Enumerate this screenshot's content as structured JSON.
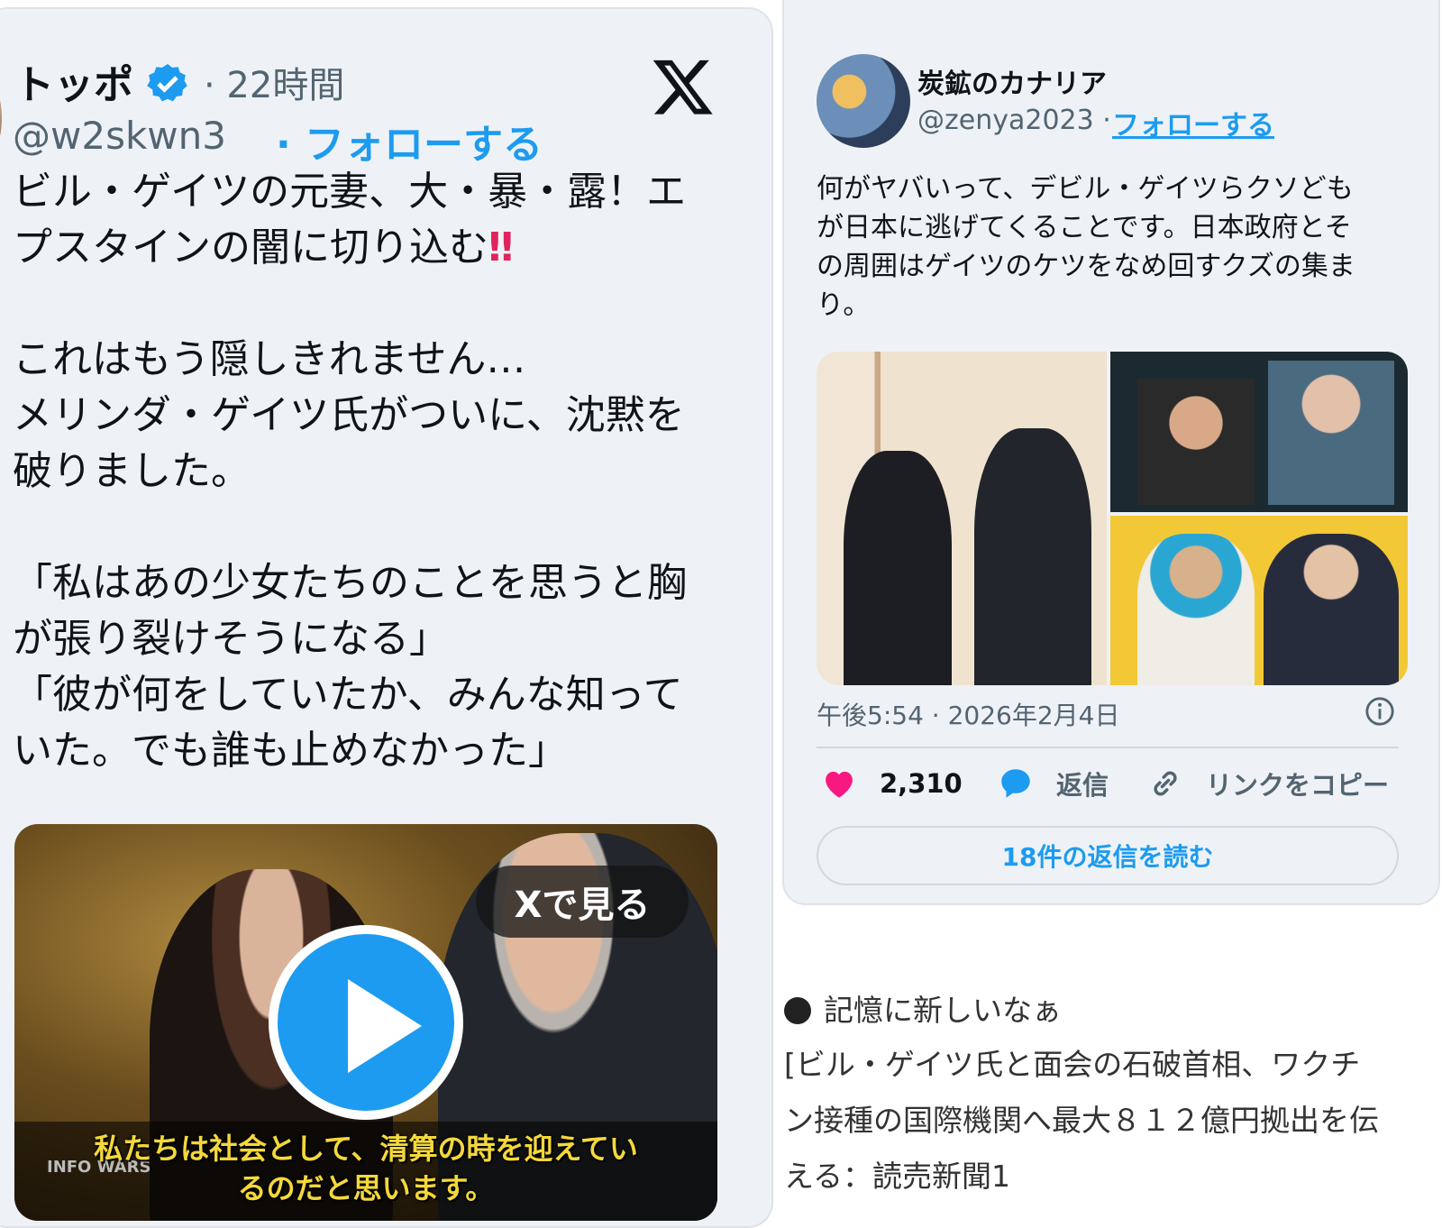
{
  "left_tweet": {
    "display_name": "トッポ",
    "time": "· 22時間",
    "handle": "@w2skwn3",
    "follow_label": "· フォローする",
    "body_lines": [
      "ビル・ゲイツの元妻、大・暴・露！エ",
      "プスタインの闇に切り込む",
      "",
      "これはもう隠しきれません…",
      "メリンダ・ゲイツ氏がついに、沈黙を",
      "破りました。",
      "",
      "「私はあの少女たちのことを思うと胸",
      "が張り裂けそうになる」",
      "「彼が何をしていたか、みんな知って",
      "いた。でも誰も止めなかった」"
    ],
    "bangs": "‼",
    "video": {
      "watch_label": "Xで見る",
      "subtitle_line1": "私たちは社会として、清算の時を迎えてい",
      "subtitle_line2": "るのだと思います。",
      "watermark": "INFO WARS"
    }
  },
  "right_tweet": {
    "display_name": "炭鉱のカナリア",
    "handle": "@zenya2023",
    "follow_label": "フォローする",
    "handle_sep": "·",
    "body_lines": [
      "何がヤバいって、デビル・ゲイツらクソども",
      "が日本に逃げてくることです。日本政府とそ",
      "の周囲はゲイツのケツをなめ回すクズの集ま",
      "り。"
    ],
    "timestamp": "午後5:54 · 2026年2月4日",
    "likes": "2,310",
    "reply_label": "返信",
    "copy_link_label": "リンクをコピー",
    "read_replies_label": "18件の返信を読む"
  },
  "note": {
    "heading": "記憶に新しいなぁ",
    "article_lines": [
      "[ビル・ゲイツ氏と面会の石破首相、ワクチ",
      "ン接種の国際機関へ最大８１２億円拠出を伝",
      "える：読売新聞1"
    ]
  },
  "colors": {
    "accent_blue": "#1d9bf0",
    "like_pink": "#f91880",
    "card_bg": "#eef2f6"
  }
}
